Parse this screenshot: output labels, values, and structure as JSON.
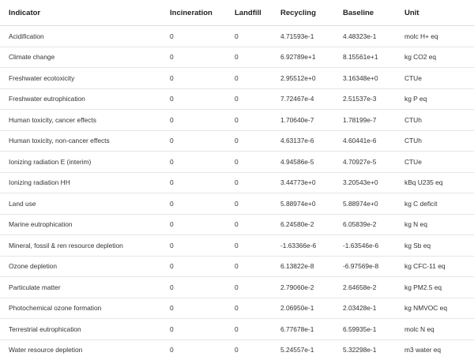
{
  "table": {
    "headers": [
      "Indicator",
      "Incineration",
      "Landfill",
      "Recycling",
      "Baseline",
      "Unit"
    ],
    "rows": [
      [
        "Acidification",
        "0",
        "0",
        "4.71593e-1",
        "4.48323e-1",
        "molc H+ eq"
      ],
      [
        "Climate change",
        "0",
        "0",
        "6.92789e+1",
        "8.15561e+1",
        "kg CO2 eq"
      ],
      [
        "Freshwater ecotoxicity",
        "0",
        "0",
        "2.95512e+0",
        "3.16348e+0",
        "CTUe"
      ],
      [
        "Freshwater eutrophication",
        "0",
        "0",
        "7.72467e-4",
        "2.51537e-3",
        "kg P eq"
      ],
      [
        "Human toxicity, cancer effects",
        "0",
        "0",
        "1.70640e-7",
        "1.78199e-7",
        "CTUh"
      ],
      [
        "Human toxicity, non-cancer effects",
        "0",
        "0",
        "4.63137e-6",
        "4.60441e-6",
        "CTUh"
      ],
      [
        "Ionizing radiation E (interim)",
        "0",
        "0",
        "4.94586e-5",
        "4.70927e-5",
        "CTUe"
      ],
      [
        "Ionizing radiation HH",
        "0",
        "0",
        "3.44773e+0",
        "3.20543e+0",
        "kBq U235 eq"
      ],
      [
        "Land use",
        "0",
        "0",
        "5.88974e+0",
        "5.88974e+0",
        "kg C deficit"
      ],
      [
        "Marine eutrophication",
        "0",
        "0",
        "6.24580e-2",
        "6.05839e-2",
        "kg N eq"
      ],
      [
        "Mineral, fossil & ren resource depletion",
        "0",
        "0",
        "-1.63366e-6",
        "-1.63546e-6",
        "kg Sb eq"
      ],
      [
        "Ozone depletion",
        "0",
        "0",
        "6.13822e-8",
        "-6.97569e-8",
        "kg CFC-11 eq"
      ],
      [
        "Particulate matter",
        "0",
        "0",
        "2.79060e-2",
        "2.64658e-2",
        "kg PM2.5 eq"
      ],
      [
        "Photochemical ozone formation",
        "0",
        "0",
        "2.06950e-1",
        "2.03428e-1",
        "kg NMVOC eq"
      ],
      [
        "Terrestrial eutrophication",
        "0",
        "0",
        "6.77678e-1",
        "6.59935e-1",
        "molc N eq"
      ],
      [
        "Water resource depletion",
        "0",
        "0",
        "5.24557e-1",
        "5.32298e-1",
        "m3 water eq"
      ]
    ]
  }
}
